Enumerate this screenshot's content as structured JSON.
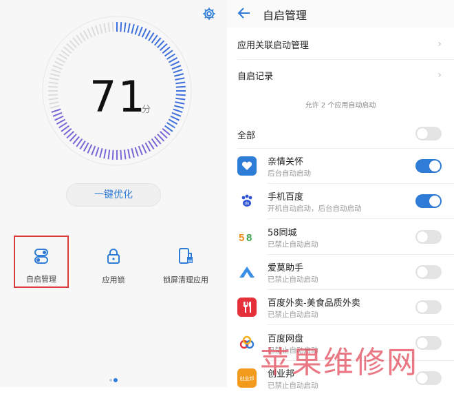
{
  "left": {
    "score": "71",
    "score_unit": "分",
    "optimize_label": "一键优化",
    "tools": [
      {
        "label": "自启管理",
        "icon": "toggle-switch-icon"
      },
      {
        "label": "应用锁",
        "icon": "lock-icon"
      },
      {
        "label": "锁屏清理应用",
        "icon": "phone-clean-icon"
      }
    ],
    "page_indicator": {
      "count": 2,
      "active": 2
    }
  },
  "right": {
    "title": "自启管理",
    "menu": [
      {
        "label": "应用关联启动管理"
      },
      {
        "label": "自启记录"
      }
    ],
    "hint": "允许 2 个应用自动启动",
    "all_label": "全部",
    "all_toggle": false,
    "apps": [
      {
        "name": "亲情关怀",
        "status": "后台自动启动",
        "enabled": true,
        "icon": "heart-care-icon"
      },
      {
        "name": "手机百度",
        "status": "开机自动启动，后台自动启动",
        "enabled": true,
        "icon": "baidu-paw-icon"
      },
      {
        "name": "58同城",
        "status": "已禁止自动启动",
        "enabled": false,
        "icon": "58-logo-icon"
      },
      {
        "name": "爱莫助手",
        "status": "已禁止自动启动",
        "enabled": false,
        "icon": "aimo-icon"
      },
      {
        "name": "百度外卖-美食品质外卖",
        "status": "已禁止自动启动",
        "enabled": false,
        "icon": "fork-knife-icon"
      },
      {
        "name": "百度网盘",
        "status": "已禁止自动启动",
        "enabled": false,
        "icon": "baidu-cloud-icon"
      },
      {
        "name": "创业邦",
        "status": "已禁止自动启动",
        "enabled": false,
        "icon": "chuangyebang-icon"
      }
    ]
  },
  "watermark": "苹果维修网",
  "colors": {
    "accent": "#2f7cd7",
    "highlight_border": "#d93a3a",
    "watermark": "#e24b5b"
  }
}
